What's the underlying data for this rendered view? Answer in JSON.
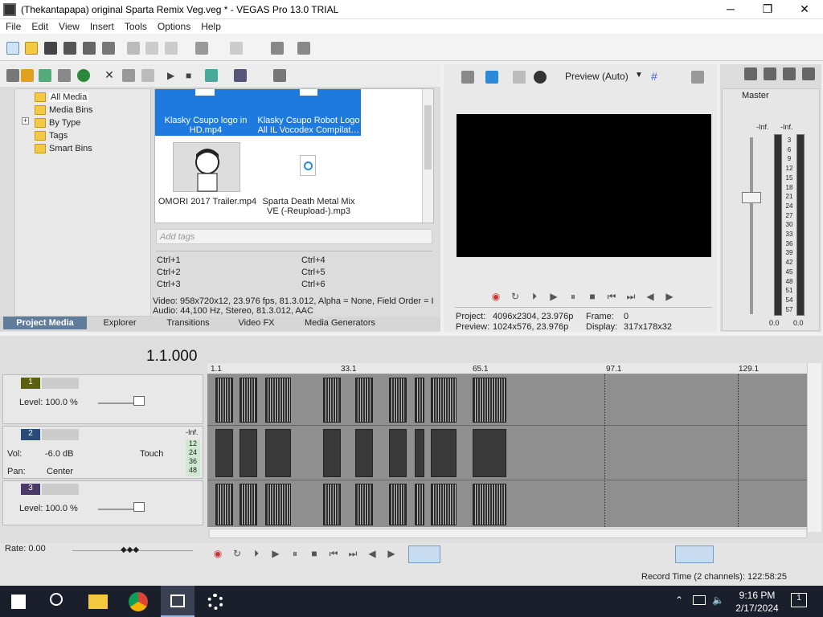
{
  "window": {
    "title": "(Thekantapapa) original Sparta Remix Veg.veg * - VEGAS Pro 13.0 TRIAL",
    "minimize": "─",
    "maximize": "❐",
    "close": "✕"
  },
  "menu": [
    "File",
    "Edit",
    "View",
    "Insert",
    "Tools",
    "Options",
    "Help"
  ],
  "tree": {
    "items": [
      "All Media",
      "Media Bins",
      "By Type",
      "Tags",
      "Smart Bins"
    ],
    "expander": "+"
  },
  "media": {
    "items": [
      {
        "caption": "Klasky Csupo logo in HD.mp4"
      },
      {
        "caption": "Klasky Csupo Robot Logo All IL Vocodex Compilat…"
      },
      {
        "caption": "OMORI 2017 Trailer.mp4"
      },
      {
        "caption": "Sparta Death Metal Mix VE (-Reupload-).mp3"
      }
    ],
    "tags_placeholder": "Add tags",
    "shortcuts": [
      "Ctrl+1",
      "Ctrl+2",
      "Ctrl+3",
      "Ctrl+4",
      "Ctrl+5",
      "Ctrl+6"
    ],
    "info_line1": "Video: 958x720x12, 23.976 fps, 81.3.012, Alpha = None, Field Order = I",
    "info_line2": "Audio: 44,100 Hz, Stereo, 81.3.012, AAC"
  },
  "tabs": [
    "Project Media",
    "Explorer",
    "Transitions",
    "Video FX",
    "Media Generators"
  ],
  "preview": {
    "mode": "Preview (Auto)",
    "project_label": "Project:",
    "project_value": "4096x2304, 23.976p",
    "preview_label": "Preview:",
    "preview_value": "1024x576, 23.976p",
    "frame_label": "Frame:",
    "frame_value": "0",
    "display_label": "Display:",
    "display_value": "317x178x32"
  },
  "master": {
    "label": "Master",
    "inf_left": "-Inf.",
    "inf_right": "-Inf.",
    "scale": [
      "3",
      "6",
      "9",
      "12",
      "15",
      "18",
      "21",
      "24",
      "27",
      "30",
      "33",
      "36",
      "39",
      "42",
      "45",
      "48",
      "51",
      "54",
      "57"
    ],
    "left_val": "0.0",
    "right_val": "0.0"
  },
  "timeline": {
    "time": "1.1.000",
    "ruler": [
      "1.1",
      "33.1",
      "65.1",
      "97.1",
      "129.1"
    ],
    "rate": "Rate: 0.00",
    "record_time": "Record Time (2 channels): 122:58:25"
  },
  "tracks": [
    {
      "num": "1",
      "level": "Level: 100.0 %"
    },
    {
      "num": "2",
      "vol_label": "Vol:",
      "vol": "-6.0 dB",
      "pan_label": "Pan:",
      "pan": "Center",
      "touch": "Touch",
      "inf": "-Inf.",
      "meter": [
        "12",
        "24",
        "36",
        "48"
      ]
    },
    {
      "num": "3",
      "level": "Level: 100.0 %"
    }
  ],
  "taskbar": {
    "time": "9:16 PM",
    "date": "2/17/2024",
    "notif": "1"
  }
}
